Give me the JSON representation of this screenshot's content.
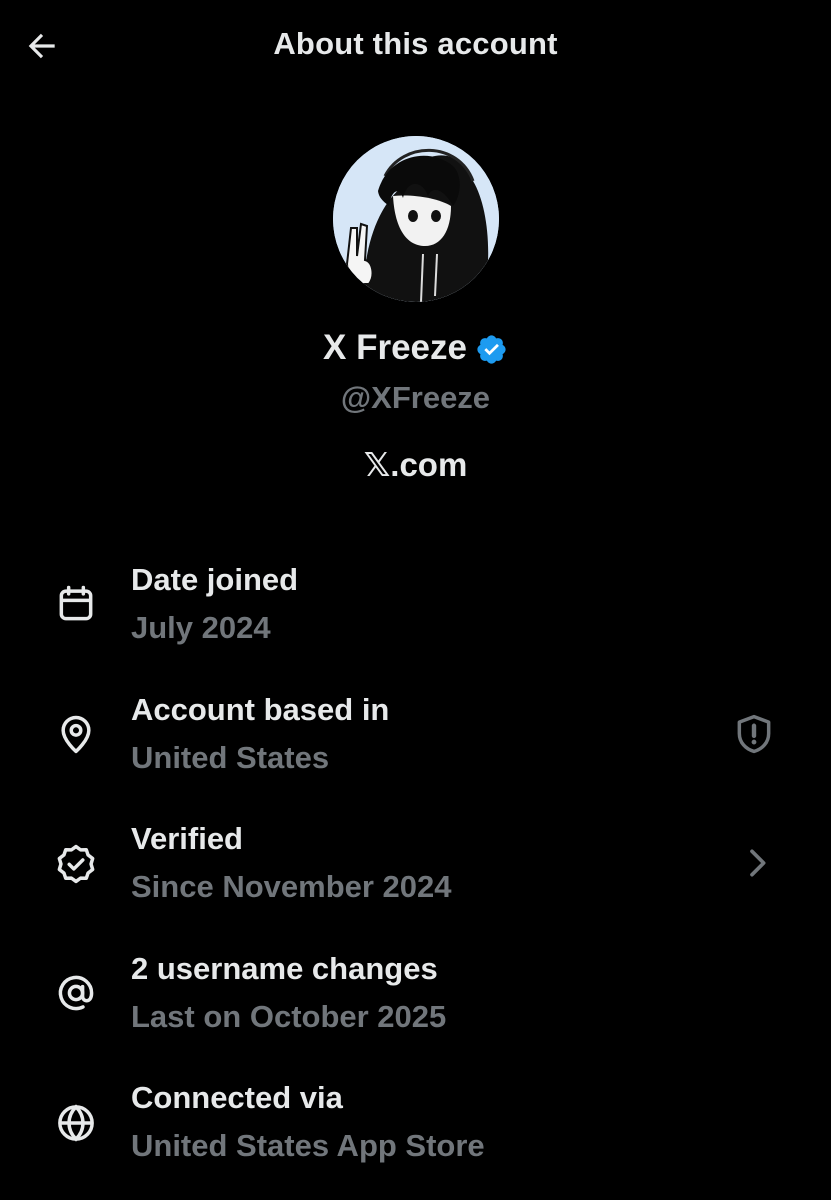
{
  "header": {
    "title": "About this account",
    "back_icon": "arrow-left-icon"
  },
  "profile": {
    "name": "X Freeze",
    "handle": "@XFreeze",
    "site": "𝕏.com",
    "verified_color": "#1d9bf0",
    "avatar_description_icon": "avatar-image"
  },
  "rows": [
    {
      "icon": "calendar-icon",
      "label": "Date joined",
      "value": "July 2024"
    },
    {
      "icon": "location-pin-icon",
      "label": "Account based in",
      "value": "United States",
      "action_icon": "shield-alert-icon"
    },
    {
      "icon": "verified-badge-icon",
      "label": "Verified",
      "value": "Since November 2024",
      "action_icon": "chevron-right-icon"
    },
    {
      "icon": "at-sign-icon",
      "label": "2 username changes",
      "value": "Last on October 2025"
    },
    {
      "icon": "globe-icon",
      "label": "Connected via",
      "value": "United States App Store"
    }
  ],
  "colors": {
    "background": "#000000",
    "primary_text": "#e7e9ea",
    "secondary_text": "#71767b",
    "accent": "#1d9bf0"
  }
}
